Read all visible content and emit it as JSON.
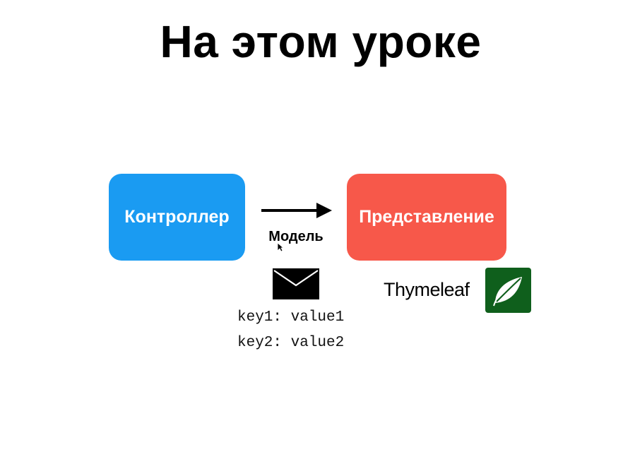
{
  "slide": {
    "title": "На этом уроке"
  },
  "diagram": {
    "controller_label": "Контроллер",
    "view_label": "Представление",
    "arrow_label": "Модель",
    "model_entries": [
      "key1: value1",
      "key2: value2"
    ],
    "template_engine": "Thymeleaf"
  },
  "colors": {
    "controller": "#1a9bf2",
    "view": "#f7584a",
    "thymeleaf_logo": "#0f5f1c"
  },
  "icons": {
    "envelope": "envelope-icon",
    "thymeleaf": "thymeleaf-logo-icon",
    "cursor": "mouse-cursor-icon"
  }
}
